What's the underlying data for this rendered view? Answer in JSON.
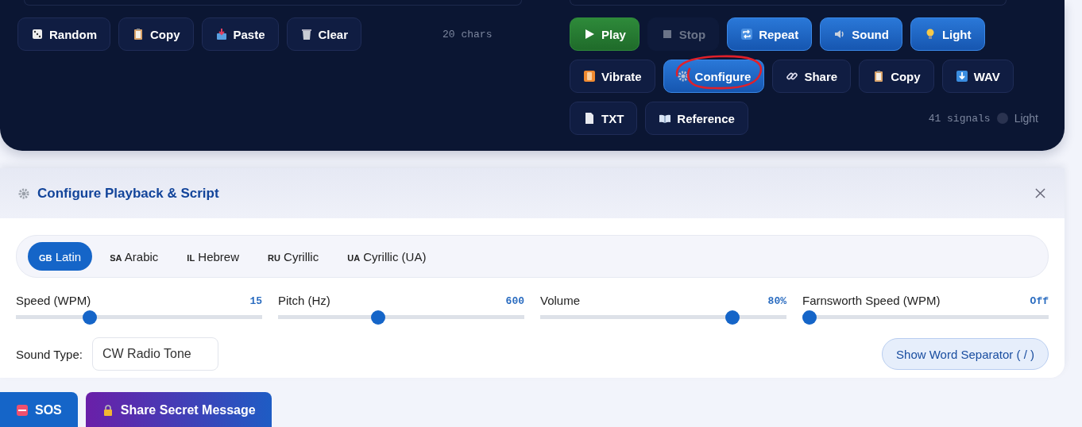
{
  "input_panel": {
    "buttons": [
      {
        "label": "Random",
        "active": false,
        "disabled": false
      },
      {
        "label": "Copy",
        "active": false,
        "disabled": false
      },
      {
        "label": "Paste",
        "active": false,
        "disabled": false
      },
      {
        "label": "Clear",
        "active": false,
        "disabled": false
      }
    ],
    "count": "20 chars"
  },
  "output_panel": {
    "buttons": [
      {
        "label": "Play",
        "kind": "go",
        "active": false,
        "disabled": false
      },
      {
        "label": "Stop",
        "kind": "plain",
        "active": false,
        "disabled": true
      },
      {
        "label": "Repeat",
        "kind": "plain",
        "active": true,
        "disabled": false
      },
      {
        "label": "Sound",
        "kind": "plain",
        "active": true,
        "disabled": false
      },
      {
        "label": "Light",
        "kind": "plain",
        "active": true,
        "disabled": false
      },
      {
        "label": "Vibrate",
        "kind": "plain",
        "active": false,
        "disabled": false
      },
      {
        "label": "Configure",
        "kind": "plain",
        "active": true,
        "disabled": false
      },
      {
        "label": "Share",
        "kind": "plain",
        "active": false,
        "disabled": false
      },
      {
        "label": "Copy",
        "kind": "plain",
        "active": false,
        "disabled": false
      },
      {
        "label": "WAV",
        "kind": "plain",
        "active": false,
        "disabled": false
      },
      {
        "label": "TXT",
        "kind": "plain",
        "active": false,
        "disabled": false
      },
      {
        "label": "Reference",
        "kind": "plain",
        "active": false,
        "disabled": false
      }
    ],
    "count": "41 signals",
    "light_toggle": {
      "label": "Light",
      "on": false
    }
  },
  "config": {
    "title": "Configure Playback & Script",
    "scripts": [
      {
        "code": "GB",
        "label": "Latin",
        "selected": true
      },
      {
        "code": "SA",
        "label": "Arabic",
        "selected": false
      },
      {
        "code": "IL",
        "label": "Hebrew",
        "selected": false
      },
      {
        "code": "RU",
        "label": "Cyrillic",
        "selected": false
      },
      {
        "code": "UA",
        "label": "Cyrillic (UA)",
        "selected": false
      }
    ],
    "sliders": [
      {
        "label": "Speed (WPM)",
        "reading": "15",
        "level": 0.3
      },
      {
        "label": "Pitch (Hz)",
        "reading": "600",
        "level": 0.405
      },
      {
        "label": "Volume",
        "reading": "80%",
        "level": 0.78
      },
      {
        "label": "Farnsworth Speed (WPM)",
        "reading": "Off",
        "level": 0.03
      }
    ],
    "sound_type": {
      "label": "Sound Type:",
      "value": "CW Radio Tone"
    },
    "separator_button": "Show Word Separator ( / )"
  },
  "actions": [
    {
      "label": "SOS",
      "kind": "sos"
    },
    {
      "label": "Share Secret Message",
      "kind": "secret"
    }
  ]
}
